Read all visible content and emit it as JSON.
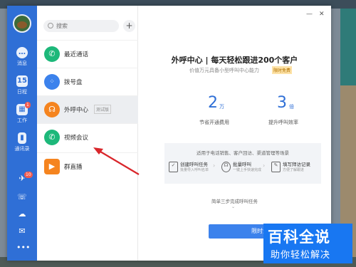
{
  "search": {
    "placeholder": "搜索"
  },
  "sidebar": {
    "items": [
      {
        "label": "消息",
        "icon": "chat-icon"
      },
      {
        "label": "日程",
        "icon": "calendar-icon",
        "icon_text": "15"
      },
      {
        "label": "工作",
        "icon": "apps-icon",
        "badge": "1"
      },
      {
        "label": "通讯录",
        "icon": "contacts-icon"
      }
    ],
    "bottom_badge": "10"
  },
  "list": {
    "items": [
      {
        "label": "最近通话",
        "icon": "phone-icon",
        "color": "#1db87a"
      },
      {
        "label": "拨号盘",
        "icon": "dialpad-icon",
        "color": "#3c82ec"
      },
      {
        "label": "外呼中心",
        "icon": "headset-icon",
        "color": "#f5841f",
        "tag": "测试版"
      },
      {
        "label": "视频会议",
        "icon": "video-call-icon",
        "color": "#1db87a"
      },
      {
        "label": "群直播",
        "icon": "live-icon",
        "color": "#f5841f"
      }
    ]
  },
  "main": {
    "title": "外呼中心 | 每天轻松跟进200个客户",
    "subtitle": "价值万元具备小型呼叫中心能力",
    "subtitle_tag": "限时免费",
    "stats": [
      {
        "value": "2",
        "unit": "万",
        "label": "节省开通费用"
      },
      {
        "value": "3",
        "unit": "倍",
        "label": "提升呼叫效率"
      }
    ],
    "scenario_title": "适用于电话销售、客户回访、渠道管理等场景",
    "steps": [
      {
        "title": "创建呼叫任务",
        "desc": "批量导入呼叫名单"
      },
      {
        "title": "批量呼叫",
        "desc": "一键上手快速完成"
      },
      {
        "title": "填写拜访记录",
        "desc": "方便了解跟进"
      }
    ],
    "help_text": "简单三步完成呼叫任务",
    "cta_label": "限时免费开通"
  },
  "watermark": {
    "main": "百科全说",
    "sub": "助你轻松解决"
  },
  "colors": {
    "accent": "#2f6fd6",
    "rail": "#2f6fd6",
    "arrow": "#d9262b"
  }
}
